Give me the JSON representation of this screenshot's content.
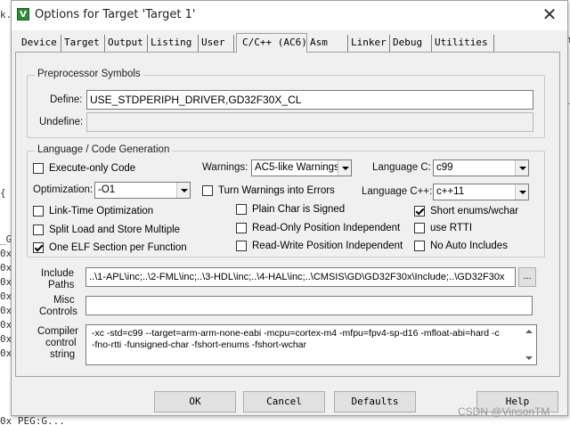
{
  "window": {
    "title": "Options for Target 'Target 1'",
    "close_glyph": "✕"
  },
  "tabs": [
    {
      "label": "Device"
    },
    {
      "label": "Target"
    },
    {
      "label": "Output"
    },
    {
      "label": "Listing"
    },
    {
      "label": "User"
    },
    {
      "label": "C/C++ (AC6)",
      "active": true
    },
    {
      "label": "Asm"
    },
    {
      "label": "Linker"
    },
    {
      "label": "Debug"
    },
    {
      "label": "Utilities"
    }
  ],
  "preprocessor": {
    "group_title": "Preprocessor Symbols",
    "define_label": "Define:",
    "define_value": "USE_STDPERIPH_DRIVER,GD32F30X_CL",
    "undefine_label": "Undefine:",
    "undefine_value": ""
  },
  "codegen": {
    "group_title": "Language / Code Generation",
    "execute_only": {
      "label": "Execute-only Code",
      "checked": false
    },
    "warnings_label": "Warnings:",
    "warnings_value": "AC5-like Warnings",
    "language_c_label": "Language C:",
    "language_c_value": "c99",
    "optimization_label": "Optimization:",
    "optimization_value": "-O1",
    "turn_warnings_errors": {
      "label": "Turn Warnings into Errors",
      "checked": false
    },
    "language_cpp_label": "Language C++:",
    "language_cpp_value": "c++11",
    "lto": {
      "label": "Link-Time Optimization",
      "checked": false
    },
    "plain_char_signed": {
      "label": "Plain Char is Signed",
      "checked": false
    },
    "short_enums": {
      "label": "Short enums/wchar",
      "checked": true
    },
    "split_load_store": {
      "label": "Split Load and Store Multiple",
      "checked": false
    },
    "ropi": {
      "label": "Read-Only Position Independent",
      "checked": false
    },
    "use_rtti": {
      "label": "use RTTI",
      "checked": false
    },
    "one_elf_section": {
      "label": "One ELF Section per Function",
      "checked": true
    },
    "rwpi": {
      "label": "Read-Write Position Independent",
      "checked": false
    },
    "no_auto_includes": {
      "label": "No Auto Includes",
      "checked": false
    }
  },
  "include": {
    "label_line1": "Include",
    "label_line2": "Paths",
    "value": "..\\1-APL\\inc;..\\2-FML\\inc;..\\3-HDL\\inc;..\\4-HAL\\inc;..\\CMSIS\\GD\\GD32F30x\\Include;..\\GD32F30x",
    "browse_label": "..."
  },
  "misc": {
    "label_line1": "Misc",
    "label_line2": "Controls",
    "value": ""
  },
  "compiler": {
    "label_line1": "Compiler",
    "label_line2": "control",
    "label_line3": "string",
    "line1": "-xc -std=c99 --target=arm-arm-none-eabi -mcpu=cortex-m4 -mfpu=fpv4-sp-d16 -mfloat-abi=hard -c",
    "line2": "-fno-rtti -funsigned-char -fshort-enums -fshort-wchar"
  },
  "buttons": {
    "ok": "OK",
    "cancel": "Cancel",
    "defaults": "Defaults",
    "help": "Help"
  },
  "watermark": "CSDN @VinsonTM",
  "background": {
    "frag_k": "k.",
    "frag_1": "{",
    "frag_2": "_G",
    "frag_3": "0x",
    "frag_4": "0x",
    "frag_5": "0x",
    "frag_6": "0x",
    "frag_7": "0x",
    "frag_8": "0x",
    "frag_9": "0x",
    "frag_10": "0x",
    "frag_bottom": "0x PEG:G...",
    "frag_right1": "ch",
    "frag_right2": "T_"
  }
}
